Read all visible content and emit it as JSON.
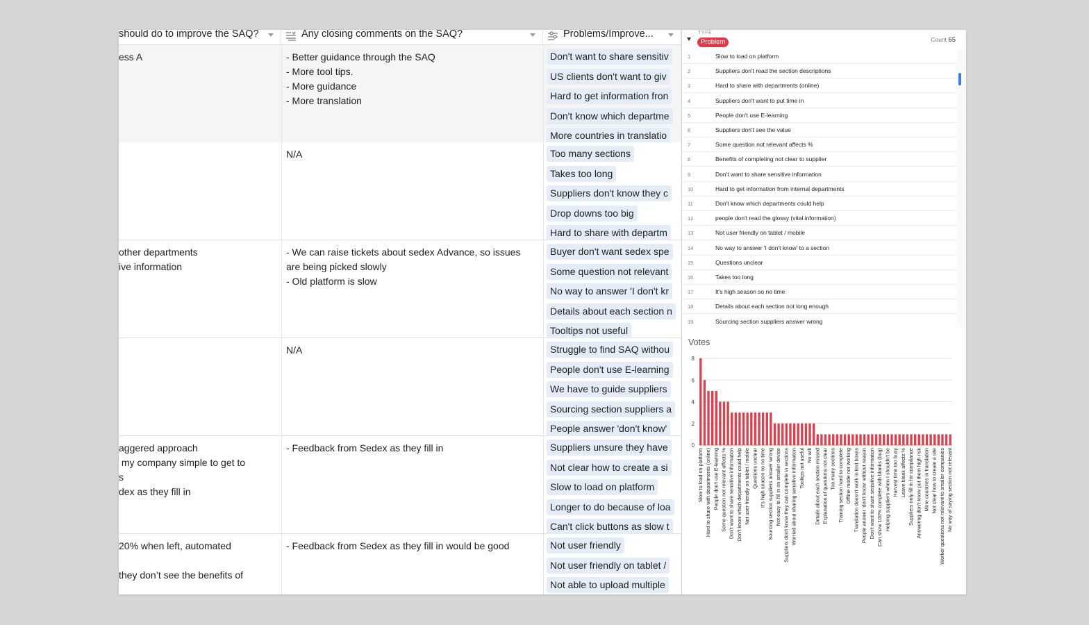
{
  "grid": {
    "columns": [
      {
        "label": "should do to improve the SAQ?",
        "icon": ""
      },
      {
        "label": "Any closing comments on the SAQ?",
        "icon": "long-text-icon"
      },
      {
        "label": "Problems/Improve...",
        "icon": "multi-select-icon"
      }
    ],
    "rows": [
      {
        "col1": "ess A",
        "col2": "- Better guidance through the SAQ\n- More tool tips.\n- More guidance\n- More translation",
        "chips": [
          "Don't want to share sensitiv",
          "US clients don't want to giv",
          "Hard to get information fron",
          "Don't know which departme",
          "More countries in translatio"
        ]
      },
      {
        "col1": "",
        "col2": "N/A",
        "chips": [
          "Too many sections",
          "Takes too long",
          "Suppliers don't know they c",
          "Drop downs too big",
          "Hard to share with departm"
        ]
      },
      {
        "col1": "other departments\nive information",
        "col2": "- We can raise tickets about sedex Advance, so issues\nare being picked slowly\n- Old platform is slow",
        "chips": [
          "Buyer don't want sedex spe",
          "Some question not relevant",
          "No way to answer 'I don't kr",
          "Details about each section n",
          "Tooltips not useful"
        ]
      },
      {
        "col1": "",
        "col2": "N/A",
        "chips": [
          "Struggle to find SAQ withou",
          "People don't use E-learning",
          "We have to guide suppliers",
          "Sourcing section suppliers a",
          "People answer 'don't know'"
        ]
      },
      {
        "col1": "aggered approach\n my company simple to get to\ns\ndex as they fill in",
        "col2": "- Feedback from Sedex as they fill in",
        "chips": [
          "Suppliers unsure they have",
          "Not clear how to create a si",
          "Slow to load on platform",
          "Longer to do because of loa",
          "Can't click buttons as slow t"
        ]
      },
      {
        "col1": "20% when left, automated\n\nthey don’t see the benefits of",
        "col2": "- Feedback from Sedex as they fill in would be good",
        "chips": [
          "Not user friendly",
          "Not user friendly on tablet /",
          "Not able to upload multiple"
        ]
      }
    ]
  },
  "panel": {
    "group_label": "TYPE",
    "group_value": "Problem",
    "count_label": "Count",
    "count_value": "65",
    "items": [
      {
        "num": "1",
        "text": "Slow to load on platform"
      },
      {
        "num": "2",
        "text": "Suppliers don't read the section descriptions"
      },
      {
        "num": "3",
        "text": "Hard to share with departments (online)"
      },
      {
        "num": "4",
        "text": "Suppliers don't want to put time in"
      },
      {
        "num": "5",
        "text": "People don't use E-learning"
      },
      {
        "num": "6",
        "text": "Suppliers don't see the value"
      },
      {
        "num": "7",
        "text": "Some question not relevant affects %"
      },
      {
        "num": "8",
        "text": "Benefits of completing not clear to supplier"
      },
      {
        "num": "9",
        "text": "Don't want to share sensitive information"
      },
      {
        "num": "10",
        "text": "Hard to get information from internal departments"
      },
      {
        "num": "11",
        "text": "Don't know which departments could help"
      },
      {
        "num": "12",
        "text": "people don't read the glossy (vital information)"
      },
      {
        "num": "13",
        "text": "Not user friendly on tablet / mobile"
      },
      {
        "num": "14",
        "text": "No way to answer 'I don't know' to a section"
      },
      {
        "num": "15",
        "text": "Questions unclear"
      },
      {
        "num": "16",
        "text": "Takes too long"
      },
      {
        "num": "17",
        "text": "It's high season so no time"
      },
      {
        "num": "18",
        "text": "Details about each section not long enough"
      },
      {
        "num": "19",
        "text": "Sourcing section suppliers answer wrong"
      }
    ],
    "accent_color": "#e03a46"
  },
  "chart_data": {
    "type": "bar",
    "title": "Votes",
    "xlabel": "",
    "ylabel": "",
    "ylim": [
      0,
      8
    ],
    "yticks": [
      0,
      2,
      4,
      6,
      8
    ],
    "grid": true,
    "bar_color": "#d9424e",
    "categories": [
      "Slow to load on platform",
      "Hard to share with departments (online)",
      "People don't use E-learning",
      "Some question not relevant affects %",
      "Don't want to share sensitive information",
      "Don't know which departments could help",
      "Not user friendly on tablet / mobile",
      "Questions unclear",
      "It's high season so no time",
      "Sourcing section suppliers answer wrong",
      "Not easy to fill in on smaller device",
      "Suppliers don't know they can complete in sections",
      "Worried about sharing sensitive information",
      "Tooltips not useful",
      "No wifi",
      "Details about each section missed",
      "Explanation of questions not clear",
      "Too many sections",
      "Training section hard to complete",
      "Offline mode not working",
      "Translation doesn't work in text boxes",
      "People answer 'don't know' without reason",
      "Don't want to share sensitive information",
      "Can show 100% complete with blanks (bug)",
      "Helping suppliers when I shouldn't be",
      "Harvest time too busy",
      "Leave blank affects %",
      "Suppliers only fill in for compliance",
      "Answering don't know put them high risk",
      "More countries in translation",
      "Not clear how to create a site",
      "Worker questions not relevant to smaller companies",
      "No way of saying section not relevant"
    ],
    "values": [
      8,
      6,
      5,
      5,
      5,
      4,
      4,
      4,
      3,
      3,
      3,
      3,
      3,
      3,
      3,
      3,
      3,
      3,
      3,
      2,
      2,
      2,
      2,
      2,
      2,
      2,
      2,
      2,
      2,
      2,
      1,
      1,
      1,
      1,
      1,
      1,
      1,
      1,
      1,
      1,
      1,
      1,
      1,
      1,
      1,
      1,
      1,
      1,
      1,
      1,
      1,
      1,
      1,
      1,
      1,
      1,
      1,
      1,
      1,
      1,
      1,
      1,
      1,
      1,
      1
    ]
  }
}
